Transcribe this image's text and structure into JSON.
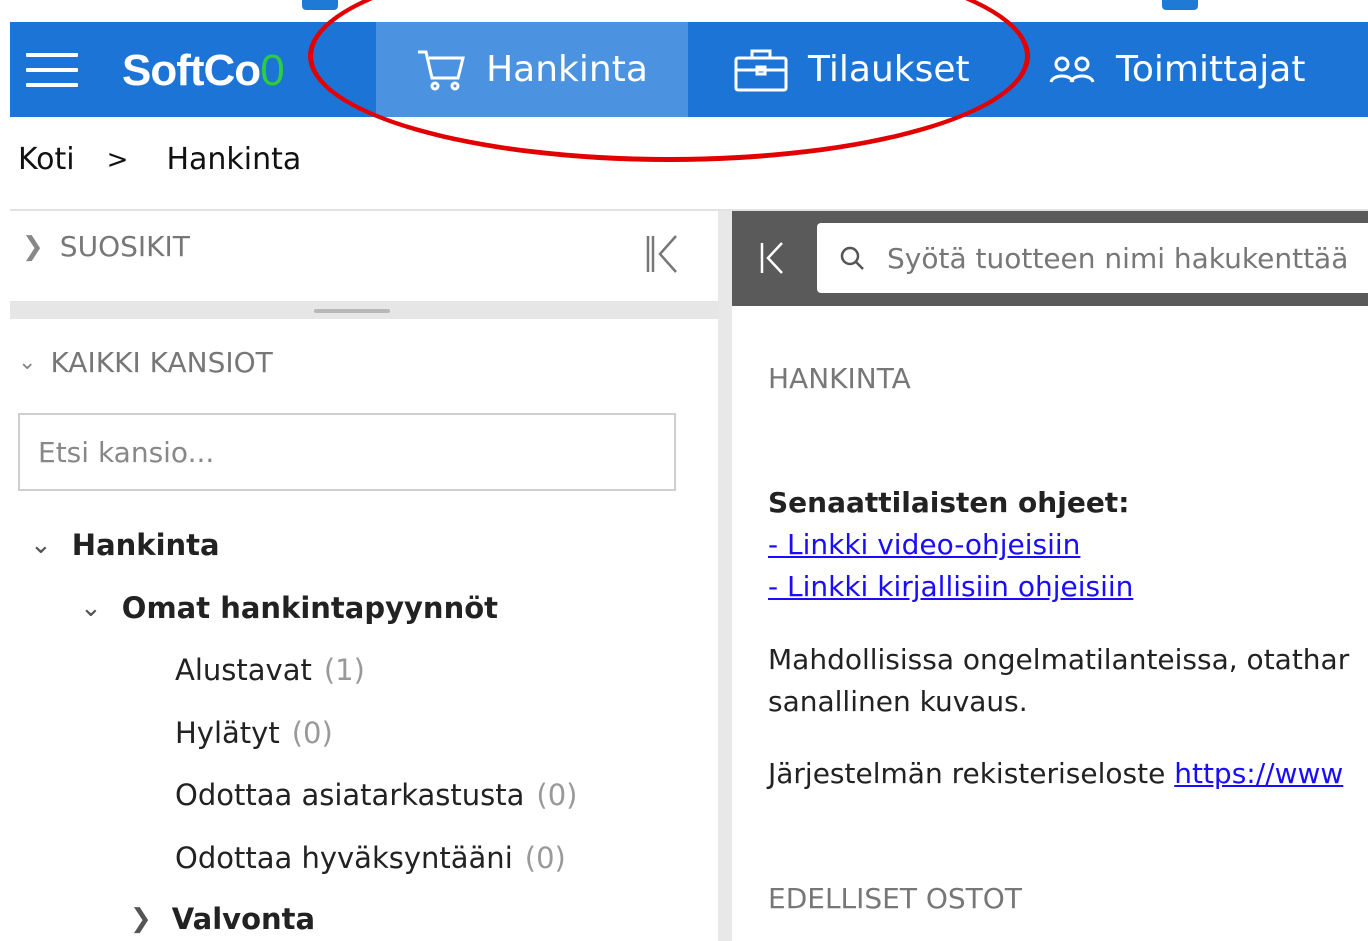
{
  "nav": {
    "brand_main": "SoftCo",
    "brand_accent": "0",
    "tabs": [
      {
        "label": "Hankinta",
        "icon": "cart-icon",
        "active": true
      },
      {
        "label": "Tilaukset",
        "icon": "briefcase-icon",
        "active": false
      },
      {
        "label": "Toimittajat",
        "icon": "users-icon",
        "active": false
      }
    ]
  },
  "breadcrumb": {
    "home": "Koti",
    "separator": ">",
    "current": "Hankinta"
  },
  "sidebar": {
    "favorites_label": "SUOSIKIT",
    "all_folders_label": "KAIKKI KANSIOT",
    "folder_search_placeholder": "Etsi kansio...",
    "tree": {
      "root": "Hankinta",
      "group": "Omat hankintapyynnöt",
      "items": [
        {
          "label": "Alustavat",
          "count": "(1)"
        },
        {
          "label": "Hylätyt",
          "count": "(0)"
        },
        {
          "label": "Odottaa asiatarkastusta",
          "count": "(0)"
        },
        {
          "label": "Odottaa hyväksyntääni",
          "count": "(0)"
        }
      ],
      "next_group": "Valvonta"
    }
  },
  "main": {
    "search_placeholder": "Syötä tuotteen nimi hakukenttää",
    "section_title": "HANKINTA",
    "instructions_heading": "Senaattilaisten ohjeet:",
    "link_video": "- Linkki video-ohjeisiin",
    "link_written": "- Linkki kirjallisiin ohjeisiin",
    "problem_text_1": "Mahdollisissa ongelmatilanteissa, otathar",
    "problem_text_2": "sanallinen kuvaus.",
    "register_text": "Järjestelmän rekisteriseloste ",
    "register_link": "https://www",
    "previous_purchases_title": "EDELLISET OSTOT"
  },
  "colors": {
    "navbar": "#1d74d7",
    "active_tab": "#4b93e0",
    "annotation": "#e30000",
    "link": "#1a0dff",
    "brand_accent": "#2ecc40"
  }
}
